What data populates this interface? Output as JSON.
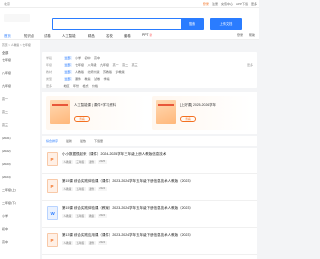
{
  "topbar": {
    "location": "北京",
    "links": [
      "登录",
      "注册",
      "充值中心",
      "APP下载",
      "更多"
    ]
  },
  "search": {
    "placeholder": "",
    "button": "搜索"
  },
  "upload_label": "上传文档",
  "nav": {
    "items": [
      "首页",
      "知识点",
      "试卷",
      "人工智能",
      "精品",
      "名校",
      "套卷",
      "PPT"
    ],
    "badge": "新",
    "right": [
      "登录",
      "帮助"
    ]
  },
  "sidebar": {
    "crumb": "首页 > 人教版 > 七年级",
    "title": "全部",
    "items": [
      "七年级",
      "八年级",
      "九年级",
      "高一",
      "高二",
      "高三",
      "(2021)",
      "(2022)",
      "(2023)",
      "(2024)",
      "二年级(上)",
      "二年级(下)",
      "小学",
      "初中",
      "高中"
    ]
  },
  "filters": {
    "rows": [
      {
        "label": "学段",
        "options": [
          "全部",
          "小学",
          "初中",
          "高中"
        ],
        "selected": 0
      },
      {
        "label": "年级",
        "options": [
          "全部",
          "七年级",
          "八年级",
          "九年级",
          "高一",
          "高二",
          "高三"
        ],
        "selected": 0
      },
      {
        "label": "教材",
        "options": [
          "全部",
          "人教版",
          "北师大版",
          "苏教版",
          "沪教版"
        ],
        "selected": 0
      },
      {
        "label": "类型",
        "options": [
          "全部",
          "课件",
          "教案",
          "试卷",
          "学案"
        ],
        "selected": 0
      },
      {
        "label": "更多",
        "options": [
          "地区",
          "年份",
          "格式",
          "价格"
        ],
        "selected": -1
      }
    ],
    "more_label": "更多"
  },
  "promo": [
    {
      "title": "人工智能课 | 课件+学习资料",
      "button": "查看"
    },
    {
      "title": "[上好课] 2025-2026学年",
      "button": "查看"
    }
  ],
  "sortbar": {
    "items": [
      "综合排序",
      "最新",
      "最热",
      "下载量"
    ],
    "selected": 0
  },
  "list": [
    {
      "type": "ppt",
      "glyph": "P",
      "title": "小小数据很起来（课件）2024-2025学年三年级上册人教版信息技术",
      "tags": [
        "人教版",
        "三年级",
        "课件",
        "2025"
      ]
    },
    {
      "type": "ppt",
      "glyph": "P",
      "title": "第15课 综合实践体验课（课件）2023-2024学年五年级下册信息技术人教版（2023）",
      "tags": [
        "人教版",
        "五年级",
        "课件",
        "2024"
      ]
    },
    {
      "type": "doc",
      "glyph": "W",
      "title": "第15课 综合实践体验课（教案）2023-2024学年五年级下册信息技术人教版（2023）",
      "tags": [
        "人教版",
        "五年级",
        "教案",
        "2024"
      ]
    },
    {
      "type": "ppt",
      "glyph": "P",
      "title": "第13课 综合实践应用课（课件）2023-2024学年五年级下册信息技术人教版（2023）",
      "tags": [
        "人教版",
        "五年级",
        "课件",
        "2024"
      ]
    }
  ]
}
